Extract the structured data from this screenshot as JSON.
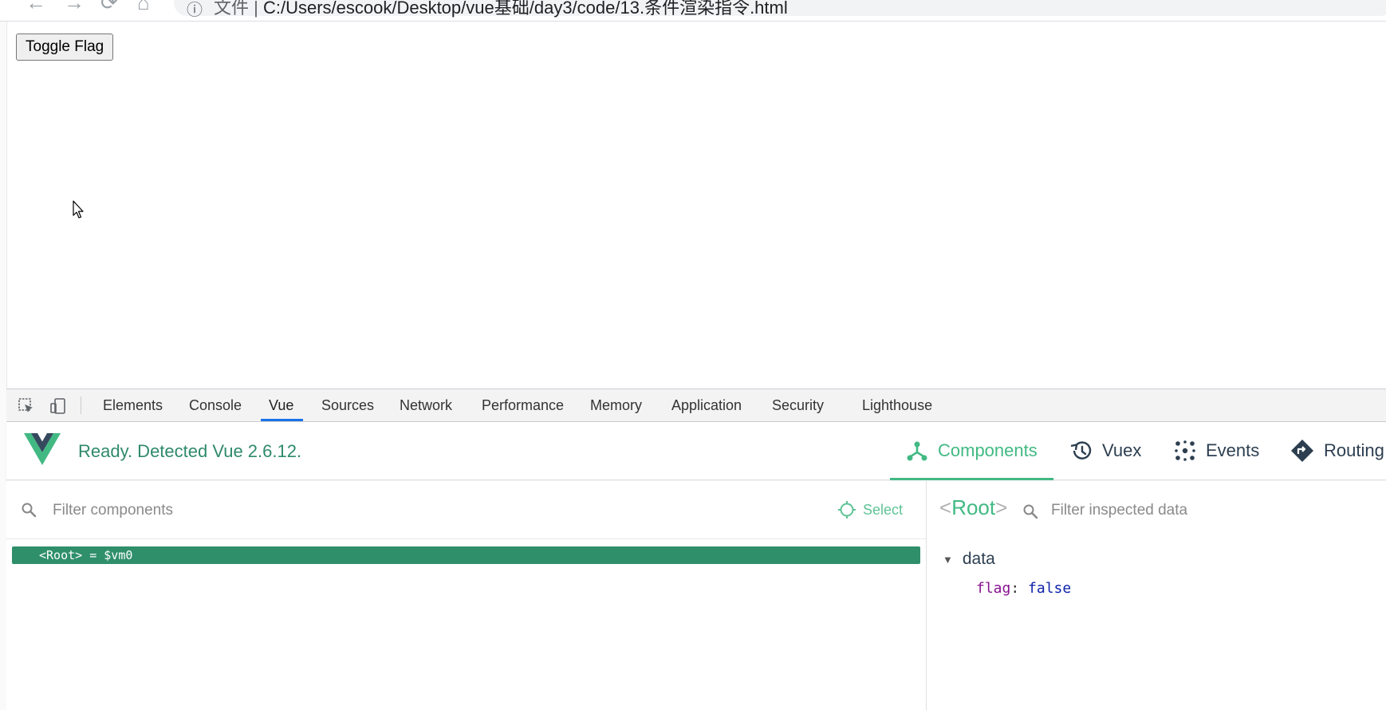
{
  "browser": {
    "url_scheme": "文件 | ",
    "url_path": "C:/Users/escook/Desktop/vue基础/day3/code/13.条件渲染指令.html"
  },
  "page": {
    "toggle_button_label": "Toggle Flag"
  },
  "devtools": {
    "tabs": [
      "Elements",
      "Console",
      "Vue",
      "Sources",
      "Network",
      "Performance",
      "Memory",
      "Application",
      "Security",
      "Lighthouse"
    ],
    "active_tab": "Vue"
  },
  "vue_devtools": {
    "status": "Ready. Detected Vue 2.6.12.",
    "tabs": {
      "components": "Components",
      "vuex": "Vuex",
      "events": "Events",
      "routing": "Routing"
    },
    "active_tab": "Components",
    "filter_components_placeholder": "Filter components",
    "select_label": "Select",
    "tree": [
      {
        "label": "<Root> = $vm0",
        "selected": true
      }
    ],
    "inspector": {
      "title_open": "<",
      "title_name": "Root",
      "title_close": ">",
      "filter_placeholder": "Filter inspected data",
      "section_label": "data",
      "props": [
        {
          "key": "flag",
          "sep": ": ",
          "value": "false"
        }
      ]
    }
  },
  "colors": {
    "vue_green": "#42b983",
    "vue_dark": "#35495e",
    "selection_bg": "#2f8f6a",
    "devtools_active_tab": "#1a73e8"
  }
}
